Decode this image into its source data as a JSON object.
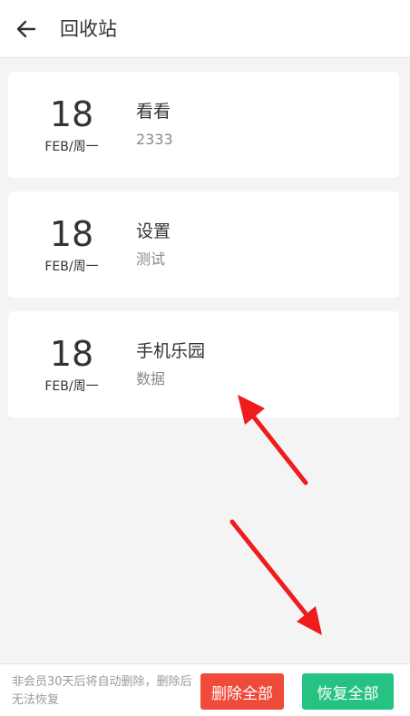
{
  "header": {
    "title": "回收站",
    "back_icon": "arrow-left-icon"
  },
  "items": [
    {
      "day": "18",
      "month_week": "FEB/周一",
      "title": "看看",
      "subtitle": "2333"
    },
    {
      "day": "18",
      "month_week": "FEB/周一",
      "title": "设置",
      "subtitle": "测试"
    },
    {
      "day": "18",
      "month_week": "FEB/周一",
      "title": "手机乐园",
      "subtitle": "数据"
    }
  ],
  "footer": {
    "notice": "非会员30天后将自动删除，删除后无法恢复",
    "delete_all_label": "删除全部",
    "restore_all_label": "恢复全部"
  },
  "colors": {
    "delete_button": "#f04a3b",
    "restore_button": "#26c281",
    "annotation_arrow": "#ee1c1c"
  }
}
